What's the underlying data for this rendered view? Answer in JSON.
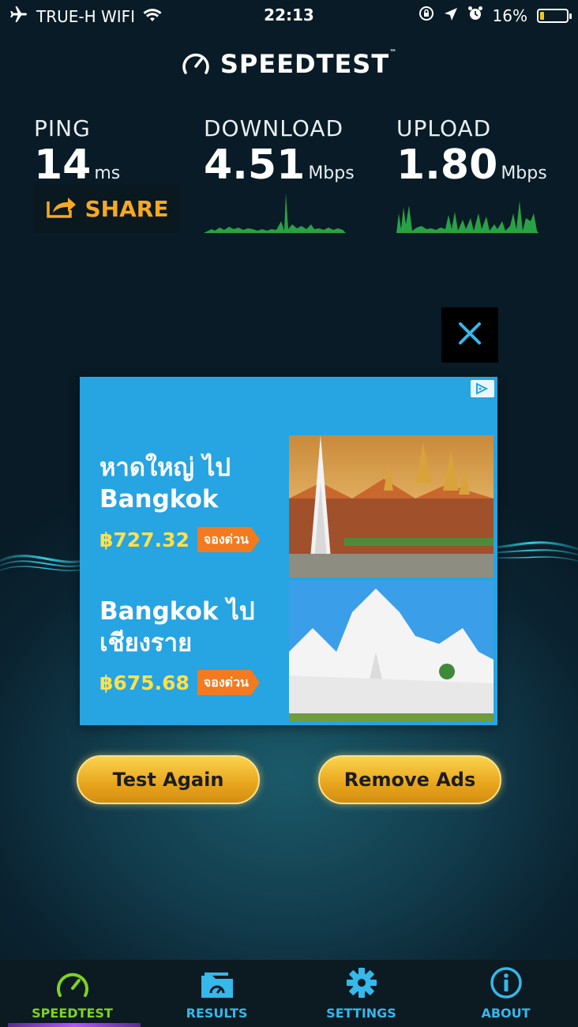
{
  "status_bar": {
    "carrier": "TRUE-H WIFI",
    "time": "22:13",
    "battery_percent_label": "16%",
    "battery_level": 0.16
  },
  "brand": {
    "name": "SPEEDTEST",
    "trademark": "™"
  },
  "results": {
    "ping": {
      "label": "PING",
      "value": "14",
      "unit": "ms"
    },
    "download": {
      "label": "DOWNLOAD",
      "value": "4.51",
      "unit": "Mbps"
    },
    "upload": {
      "label": "UPLOAD",
      "value": "1.80",
      "unit": "Mbps"
    }
  },
  "share_label": "SHARE",
  "ad": {
    "offers": [
      {
        "title_line1": "หาดใหญ่ ไป",
        "title_line2": "Bangkok",
        "price": "฿727.32",
        "cta": "จองด่วน"
      },
      {
        "title_line1": "Bangkok ไป",
        "title_line2": "เชียงราย",
        "price": "฿675.68",
        "cta": "จองด่วน"
      }
    ]
  },
  "buttons": {
    "test_again": "Test Again",
    "remove_ads": "Remove Ads"
  },
  "tabs": [
    {
      "label": "SPEEDTEST",
      "icon": "speedometer-icon",
      "active": true
    },
    {
      "label": "RESULTS",
      "icon": "folder-gauge-icon",
      "active": false
    },
    {
      "label": "SETTINGS",
      "icon": "gear-icon",
      "active": false
    },
    {
      "label": "ABOUT",
      "icon": "info-icon",
      "active": false
    }
  ],
  "colors": {
    "accent_green": "#7ed321",
    "tab_blue": "#35b8ea",
    "share_orange": "#f7a823",
    "ad_blue": "#27a4e2",
    "price_yellow": "#ffe14a",
    "cta_orange": "#f47a1f",
    "button_gold": "#f0b429",
    "chart_green": "#2fb84a"
  }
}
